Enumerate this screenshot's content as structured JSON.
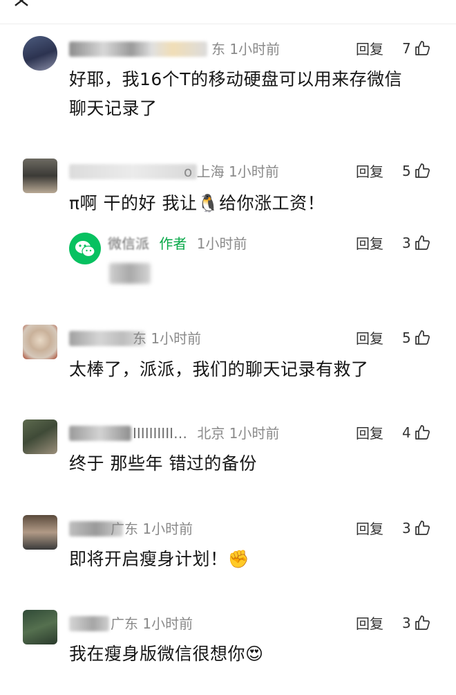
{
  "comments": [
    {
      "region": "东",
      "time": "1小时前",
      "text_lines": [
        "好耶，我16个T的移动硬盘可以用来存微信",
        "聊天记录了"
      ],
      "reply": "回复",
      "likes": "7"
    },
    {
      "region": "上海",
      "time": "1小时前",
      "text": "π啊 干的好 我让🐧给你涨工资！",
      "reply": "回复",
      "likes": "5",
      "sub_reply": {
        "name": "微信派",
        "author_tag": "作者",
        "time": "1小时前",
        "reply": "回复",
        "likes": "3"
      }
    },
    {
      "region": "东",
      "time": "1小时前",
      "text": "太棒了，派派，我们的聊天记录有救了",
      "reply": "回复",
      "likes": "5"
    },
    {
      "name_suffix": "IIIIIIIIII…",
      "region": "北京",
      "time": "1小时前",
      "text": "终于 那些年 错过的备份",
      "reply": "回复",
      "likes": "4"
    },
    {
      "region": "广东",
      "time": "1小时前",
      "text": "即将开启瘦身计划！✊",
      "reply": "回复",
      "likes": "3"
    },
    {
      "region": "广东",
      "time": "1小时前",
      "text": "我在瘦身版微信很想你😍",
      "reply": "回复",
      "likes": "3"
    }
  ],
  "colors": {
    "author_tag": "#07a848",
    "meta_text": "#8a8a8a",
    "body_text": "#161616"
  }
}
